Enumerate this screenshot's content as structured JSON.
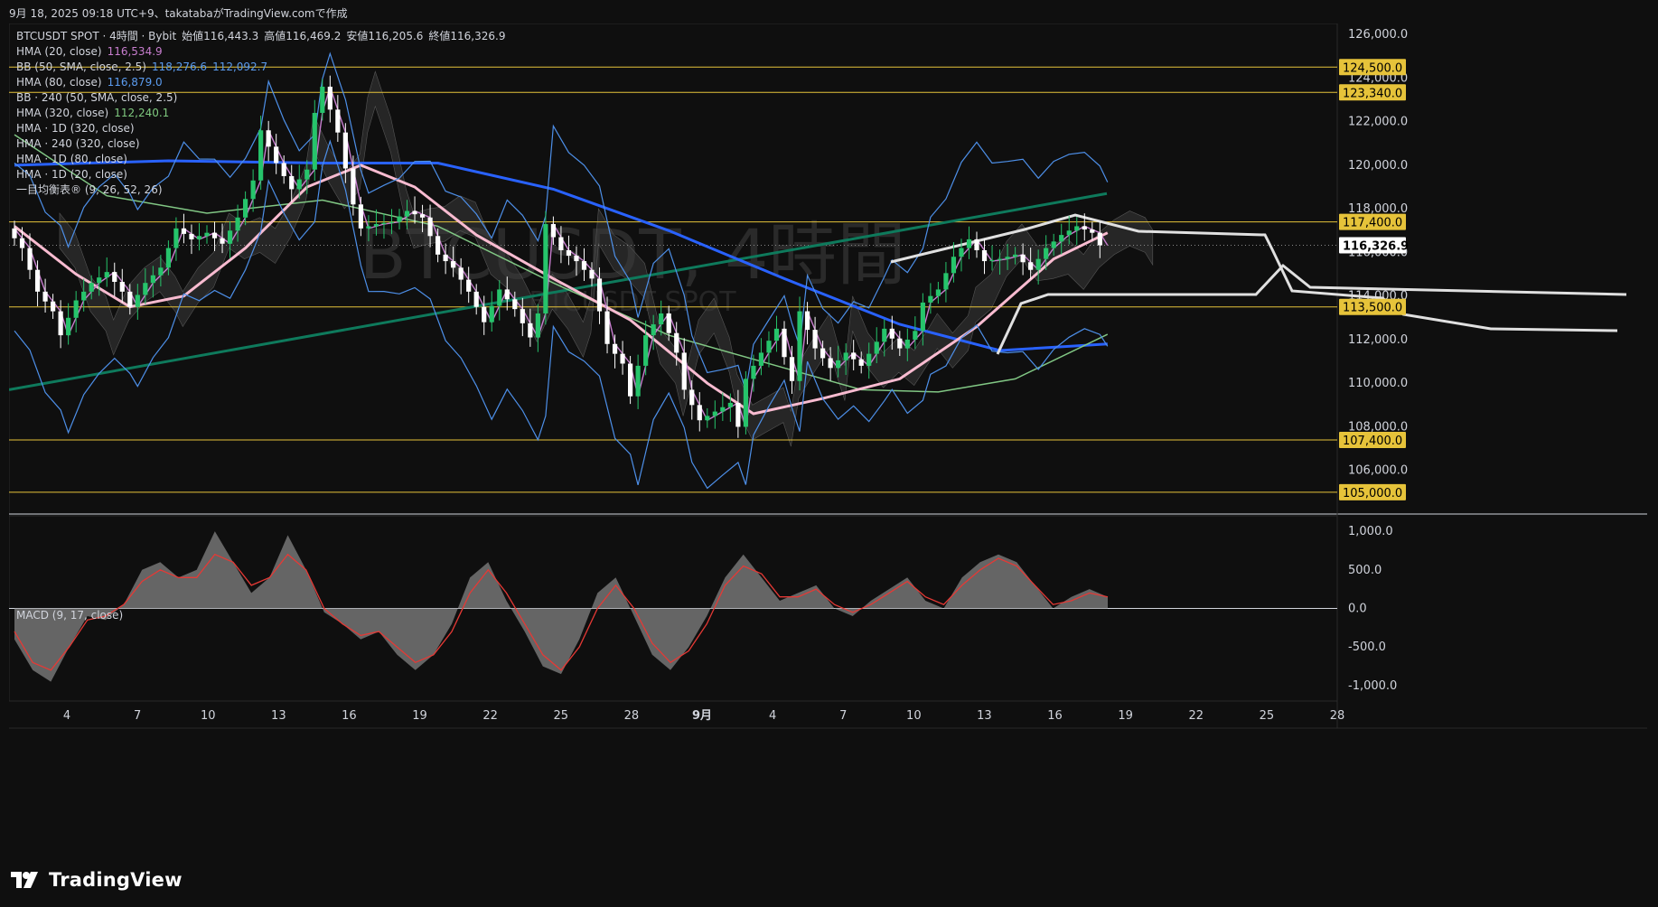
{
  "header": "9月 18, 2025 09:18 UTC+9、takatabaがTradingView.comで作成",
  "brand": "TradingView",
  "watermark": {
    "main": "BTCUSDT, 4時間",
    "sub": "BTCUSDT SPOT"
  },
  "legend": [
    {
      "label": "BTCUSDT SPOT · 4時間 · Bybit",
      "values": [
        {
          "k": "始値",
          "v": "116,443.3"
        },
        {
          "k": "高値",
          "v": "116,469.2"
        },
        {
          "k": "安値",
          "v": "116,205.6"
        },
        {
          "k": "終値",
          "v": "116,326.9"
        }
      ]
    },
    {
      "label": "HMA (20, close)",
      "value": "116,534.9",
      "color": "#c77dce"
    },
    {
      "label": "BB (50, SMA, close, 2.5)",
      "value": "118,276.6",
      "value2": "112,092.7",
      "color": "#5b9cf0"
    },
    {
      "label": "HMA (80, close)",
      "value": "116,879.0",
      "color": "#5b9cf0"
    },
    {
      "label": "BB · 240 (50, SMA, close, 2.5)"
    },
    {
      "label": "HMA (320, close)",
      "value": "112,240.1",
      "color": "#7fc97f"
    },
    {
      "label": "HMA · 1D (320, close)"
    },
    {
      "label": "HMA · 240 (320, close)"
    },
    {
      "label": "HMA · 1D (80, close)"
    },
    {
      "label": "HMA · 1D (20, close)"
    },
    {
      "label": "一目均衡表® (9, 26, 52, 26)"
    }
  ],
  "macd_label": "MACD (9, 17, close)",
  "colors": {
    "up": "#26c46b",
    "down": "#ffffff",
    "hline": "#e6c33a",
    "bb": "#4d8fe8",
    "hma_blue": "#2962ff",
    "hma_pink": "#f8bbd0",
    "hma_green": "#81c784",
    "trend": "#0e7a5c",
    "macd_area": "#7a7a7a",
    "signal": "#e53935"
  },
  "chart_data": {
    "type": "candlestick",
    "yaxis": {
      "range": [
        104000,
        126500
      ],
      "ticks": [
        "126,000.0",
        "124,000.0",
        "122,000.0",
        "120,000.0",
        "118,000.0",
        "116,000.0",
        "114,000.0",
        "112,000.0",
        "110,000.0",
        "108,000.0",
        "106,000.0"
      ]
    },
    "price_labels": [
      {
        "text": "124,500.0",
        "value": 124500,
        "kind": "line"
      },
      {
        "text": "123,340.0",
        "value": 123340,
        "kind": "line"
      },
      {
        "text": "117,400.0",
        "value": 117400,
        "kind": "line"
      },
      {
        "text": "116,326.9",
        "value": 116326.9,
        "kind": "last"
      },
      {
        "text": "113,500.0",
        "value": 113500,
        "kind": "line"
      },
      {
        "text": "107,400.0",
        "value": 107400,
        "kind": "line"
      },
      {
        "text": "105,000.0",
        "value": 105000,
        "kind": "line"
      }
    ],
    "xaxis": {
      "labels": [
        "4",
        "7",
        "10",
        "13",
        "16",
        "19",
        "22",
        "25",
        "28",
        "9月",
        "4",
        "7",
        "10",
        "13",
        "16",
        "19",
        "22",
        "25",
        "28"
      ]
    },
    "close_path": [
      [
        0,
        117100
      ],
      [
        2,
        116200
      ],
      [
        4,
        114200
      ],
      [
        6,
        113300
      ],
      [
        7,
        112200
      ],
      [
        9,
        113800
      ],
      [
        11,
        114600
      ],
      [
        13,
        115100
      ],
      [
        15,
        114200
      ],
      [
        16,
        113500
      ],
      [
        18,
        114600
      ],
      [
        20,
        115300
      ],
      [
        22,
        117100
      ],
      [
        24,
        116600
      ],
      [
        26,
        116900
      ],
      [
        28,
        116400
      ],
      [
        30,
        117600
      ],
      [
        32,
        119300
      ],
      [
        33,
        121600
      ],
      [
        35,
        120100
      ],
      [
        37,
        118900
      ],
      [
        39,
        119800
      ],
      [
        40,
        122400
      ],
      [
        41,
        123600
      ],
      [
        43,
        121500
      ],
      [
        45,
        118200
      ],
      [
        46,
        117100
      ],
      [
        48,
        117300
      ],
      [
        50,
        117400
      ],
      [
        52,
        117900
      ],
      [
        54,
        117600
      ],
      [
        56,
        115900
      ],
      [
        58,
        115300
      ],
      [
        60,
        114200
      ],
      [
        62,
        112800
      ],
      [
        64,
        114300
      ],
      [
        66,
        113400
      ],
      [
        68,
        112100
      ],
      [
        69,
        113200
      ],
      [
        70,
        117300
      ],
      [
        72,
        116100
      ],
      [
        74,
        115600
      ],
      [
        76,
        114800
      ],
      [
        78,
        111800
      ],
      [
        80,
        110900
      ],
      [
        81,
        109400
      ],
      [
        83,
        112200
      ],
      [
        85,
        113200
      ],
      [
        87,
        111400
      ],
      [
        88,
        109700
      ],
      [
        90,
        108300
      ],
      [
        92,
        108700
      ],
      [
        94,
        109100
      ],
      [
        95,
        108000
      ],
      [
        96,
        110200
      ],
      [
        98,
        111400
      ],
      [
        100,
        112500
      ],
      [
        101,
        111200
      ],
      [
        102,
        110100
      ],
      [
        103,
        113300
      ],
      [
        105,
        111600
      ],
      [
        107,
        110700
      ],
      [
        109,
        111400
      ],
      [
        111,
        110800
      ],
      [
        113,
        111900
      ],
      [
        114,
        112500
      ],
      [
        116,
        111600
      ],
      [
        118,
        112400
      ],
      [
        119,
        113700
      ],
      [
        121,
        114300
      ],
      [
        123,
        115800
      ],
      [
        125,
        116600
      ],
      [
        127,
        115600
      ],
      [
        129,
        115700
      ],
      [
        131,
        115900
      ],
      [
        133,
        115200
      ],
      [
        135,
        116200
      ],
      [
        137,
        116800
      ],
      [
        139,
        117200
      ],
      [
        141,
        116900
      ],
      [
        142,
        116326.9
      ]
    ],
    "macd": {
      "range": [
        -1200,
        1200
      ],
      "ticks": [
        "1,000.0",
        "500.0",
        "0.0",
        "-500.0",
        "-1,000.0"
      ],
      "series": [
        {
          "name": "MACD",
          "values": [
            -400,
            -800,
            -950,
            -500,
            -100,
            -150,
            50,
            500,
            600,
            400,
            500,
            1000,
            600,
            200,
            400,
            950,
            500,
            -50,
            -200,
            -400,
            -300,
            -600,
            -800,
            -600,
            -200,
            400,
            600,
            100,
            -300,
            -750,
            -850,
            -400,
            200,
            400,
            -100,
            -600,
            -800,
            -500,
            -100,
            400,
            700,
            400,
            100,
            200,
            300,
            0,
            -100,
            100,
            250,
            400,
            100,
            0,
            400,
            600,
            700,
            600,
            300,
            0,
            150,
            250,
            150
          ]
        },
        {
          "name": "Signal",
          "values": [
            -300,
            -700,
            -800,
            -500,
            -150,
            -100,
            50,
            350,
            500,
            400,
            400,
            700,
            600,
            300,
            400,
            700,
            500,
            0,
            -200,
            -350,
            -300,
            -500,
            -700,
            -600,
            -300,
            200,
            500,
            200,
            -200,
            -600,
            -800,
            -500,
            0,
            300,
            0,
            -450,
            -700,
            -550,
            -200,
            300,
            550,
            450,
            150,
            150,
            250,
            50,
            -50,
            50,
            200,
            350,
            150,
            50,
            300,
            500,
            650,
            550,
            300,
            50,
            100,
            200,
            150
          ]
        }
      ]
    }
  }
}
